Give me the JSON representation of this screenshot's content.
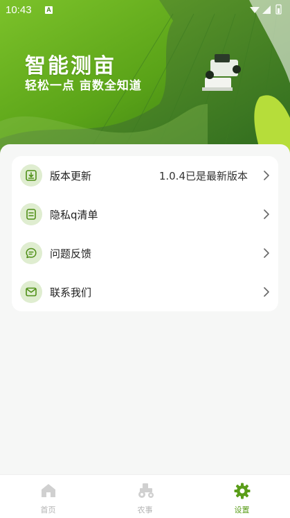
{
  "status_bar": {
    "time": "10:43",
    "notification_badge": "A"
  },
  "banner": {
    "title": "智能测亩",
    "subtitle": "轻松一点  亩数全知道"
  },
  "menu": [
    {
      "label": "版本更新",
      "value": "1.0.4已是最新版本",
      "icon": "download-icon"
    },
    {
      "label": "隐私q清单",
      "value": "",
      "icon": "document-icon"
    },
    {
      "label": "问题反馈",
      "value": "",
      "icon": "chat-icon"
    },
    {
      "label": "联系我们",
      "value": "",
      "icon": "mail-icon"
    }
  ],
  "tabs": [
    {
      "label": "首页",
      "icon": "home-icon",
      "active": false
    },
    {
      "label": "农事",
      "icon": "tractor-icon",
      "active": false
    },
    {
      "label": "设置",
      "icon": "gear-icon",
      "active": true
    }
  ],
  "colors": {
    "accent": "#5a9d19",
    "icon_bg": "#dfedd0",
    "inactive": "#b3b3b3"
  }
}
